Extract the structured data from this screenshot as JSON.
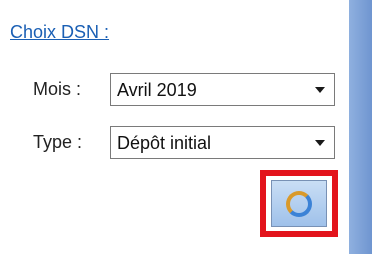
{
  "section_title": "Choix DSN :",
  "fields": {
    "mois": {
      "label": "Mois :",
      "value": "Avril 2019"
    },
    "type": {
      "label": "Type :",
      "value": "Dépôt initial"
    }
  },
  "button": {
    "icon": "refresh-icon"
  },
  "colors": {
    "highlight": "#e3141c",
    "link": "#1a5fb4",
    "panel_border": "#7b9fd6"
  }
}
